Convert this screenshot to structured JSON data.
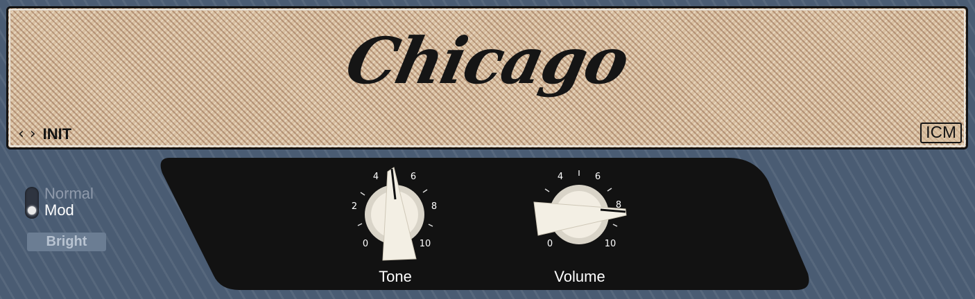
{
  "header": {
    "logo": "Chicago",
    "preset_name": "INIT",
    "prev_icon": "chevron-left-icon",
    "next_icon": "chevron-right-icon",
    "brand": "ICM"
  },
  "mode_switch": {
    "options": [
      "Normal",
      "Mod"
    ],
    "selected": "Mod"
  },
  "bright_button": {
    "label": "Bright",
    "active": false
  },
  "knobs": {
    "tone": {
      "label": "Tone",
      "value": 4.5,
      "min": 0,
      "max": 10,
      "scale_labels": [
        "0",
        "2",
        "4",
        "6",
        "8",
        "10"
      ]
    },
    "volume": {
      "label": "Volume",
      "value": 8.5,
      "min": 0,
      "max": 10,
      "scale_labels": [
        "0",
        "4",
        "6",
        "8",
        "10"
      ]
    }
  },
  "colors": {
    "background": "#4a5c73",
    "panel": "#121212",
    "knob_cap": "#efe9dc",
    "grille": "#d8bfa0",
    "text_light": "#ffffff"
  }
}
